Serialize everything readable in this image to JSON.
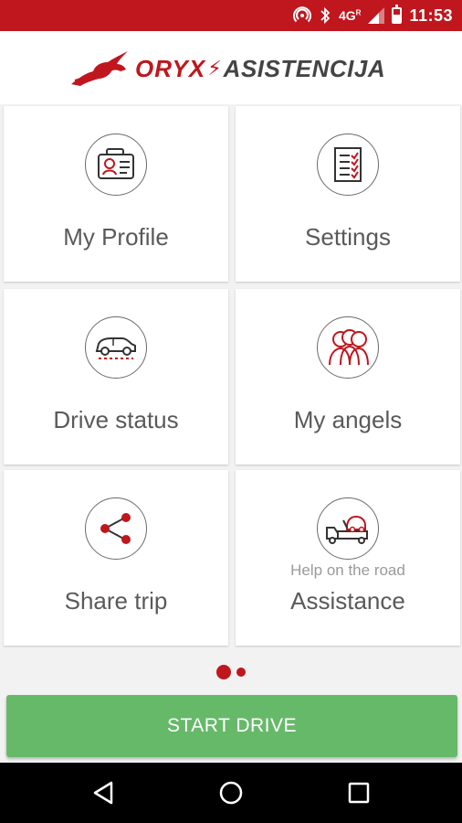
{
  "status_bar": {
    "network": "4G",
    "network_sup": "R",
    "time": "11:53",
    "icons": [
      "hotspot-icon",
      "bluetooth-icon",
      "signal-icon",
      "battery-icon"
    ]
  },
  "header": {
    "logo_word1": "ORYX",
    "logo_word2": "ASISTENCIJA",
    "brand_color": "#c0161d"
  },
  "tiles": [
    {
      "label": "My Profile",
      "icon": "id-card-icon"
    },
    {
      "label": "Settings",
      "icon": "checklist-icon"
    },
    {
      "label": "Drive status",
      "icon": "car-icon"
    },
    {
      "label": "My angels",
      "icon": "people-icon"
    },
    {
      "label": "Share trip",
      "icon": "share-icon"
    },
    {
      "label": "Assistance",
      "sublabel": "Help on the road",
      "icon": "tow-truck-icon"
    }
  ],
  "pager": {
    "pages": 2,
    "current": 1
  },
  "start_button": {
    "label": "START DRIVE",
    "color": "#67b96a"
  },
  "nav": {
    "icons": [
      "back-icon",
      "home-icon",
      "recents-icon"
    ]
  }
}
